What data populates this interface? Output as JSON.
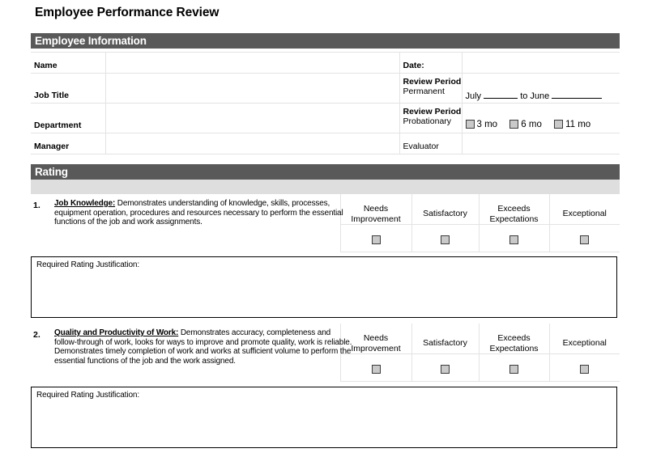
{
  "document": {
    "title": "Employee Performance Review"
  },
  "sections": {
    "employee_information": {
      "header": "Employee Information",
      "fields": {
        "name_label": "Name",
        "name_value": "",
        "job_title_label": "Job Title",
        "job_title_value": "",
        "department_label": "Department",
        "department_value": "",
        "manager_label": "Manager",
        "manager_value": "",
        "date_label": "Date:",
        "date_value": "",
        "review_period_permanent_label_line1": "Review Period",
        "review_period_permanent_label_line2": "Permanent",
        "review_period_permanent_prefix": "July",
        "review_period_permanent_middle": "to June",
        "review_period_probationary_label_line1": "Review Period",
        "review_period_probationary_label_line2": "Probationary",
        "evaluator_label": "Evaluator",
        "evaluator_value": ""
      },
      "probationary_options": [
        {
          "id": "3mo",
          "label": "3 mo",
          "checked": false
        },
        {
          "id": "6mo",
          "label": "6 mo",
          "checked": false
        },
        {
          "id": "11mo",
          "label": "11 mo",
          "checked": false
        }
      ]
    },
    "rating": {
      "header": "Rating",
      "columns": [
        {
          "label_line1": "Needs",
          "label_line2": "Improvement"
        },
        {
          "label_line1": "Satisfactory",
          "label_line2": ""
        },
        {
          "label_line1": "Exceeds",
          "label_line2": "Expectations"
        },
        {
          "label_line1": "Exceptional",
          "label_line2": ""
        }
      ],
      "items": [
        {
          "number": "1.",
          "title": "Job Knowledge:",
          "description": " Demonstrates understanding of knowledge, skills, processes, equipment operation, procedures and resources necessary to perform the essential functions of the job and work assignments.",
          "justification_label": "Required Rating Justification:",
          "justification_value": ""
        },
        {
          "number": "2.",
          "title": "Quality and Productivity of Work:",
          "description": " Demonstrates accuracy, completeness and follow-through of work, looks for ways to improve and promote quality, work is reliable.  Demonstrates timely completion of work and works at sufficient volume to perform the essential functions of the job and the work assigned.",
          "justification_label": "Required Rating Justification:",
          "justification_value": ""
        }
      ]
    }
  },
  "colors": {
    "section_header_bg": "#595959",
    "section_header_text": "#ffffff",
    "gray_band": "#dedede",
    "checkbox_fill": "#c9c9c9",
    "grid_line": "#e3e3e3"
  }
}
